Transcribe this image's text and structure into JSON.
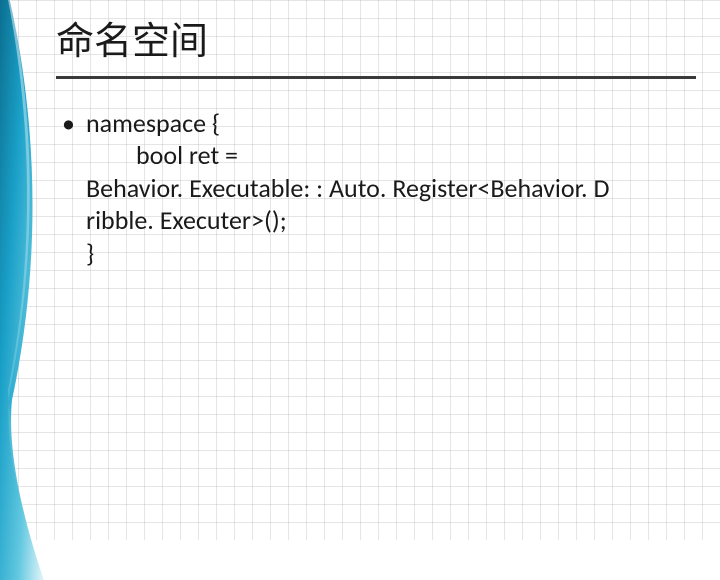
{
  "slide": {
    "title": "命名空间",
    "bullet_lead": "namespace {",
    "code_line_1": "bool ret =",
    "code_line_2": "Behavior. Executable: : Auto. Register<Behavior. D",
    "code_line_3": "ribble. Executer>();",
    "code_line_4": "}"
  }
}
